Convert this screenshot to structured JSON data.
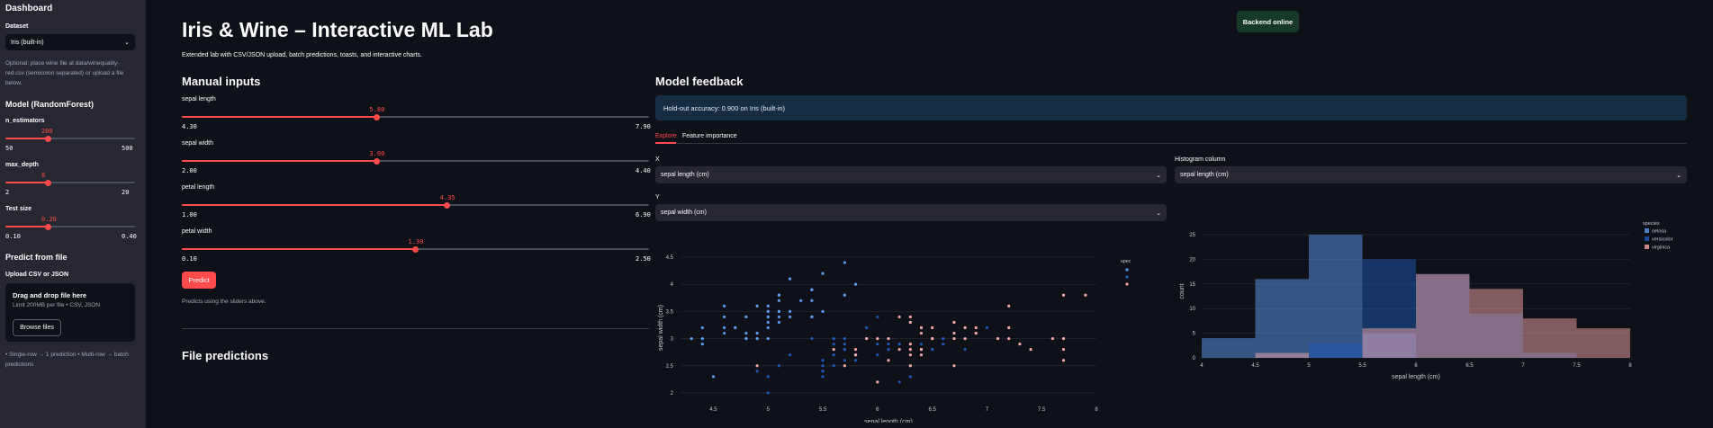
{
  "sidebar": {
    "title": "Dashboard",
    "dataset_label": "Dataset",
    "dataset_value": "Iris (built-in)",
    "dataset_help": [
      "Optional: place wine file at data/winequality-",
      "red.csv (semicolon separated) or upload a file",
      "below."
    ],
    "model_heading": "Model (RandomForest)",
    "sliders": [
      {
        "label": "n_estimators",
        "value": "200",
        "min": "50",
        "max": "500",
        "fraction": 0.333
      },
      {
        "label": "max_depth",
        "value": "8",
        "min": "2",
        "max": "20",
        "fraction": 0.333
      },
      {
        "label": "Test size",
        "value": "0.20",
        "min": "0.10",
        "max": "0.40",
        "fraction": 0.333
      }
    ],
    "predict_heading": "Predict from file",
    "upload_label": "Upload CSV or JSON",
    "upload_title": "Drag and drop file here",
    "upload_limit": "Limit 200MB per file • CSV, JSON",
    "browse_label": "Browse files",
    "note": [
      "• Single-row → 1 prediction • Multi-row → batch",
      "predictions"
    ]
  },
  "header": {
    "title": "Iris & Wine – Interactive ML Lab",
    "subtitle": "Extended lab with CSV/JSON upload, batch predictions, toasts, and interactive charts.",
    "backend_status": "Backend online"
  },
  "manual": {
    "heading": "Manual inputs",
    "sliders": [
      {
        "label": "sepal length",
        "value": "5.80",
        "min": "4.30",
        "max": "7.90",
        "fraction": 0.417
      },
      {
        "label": "sepal width",
        "value": "3.00",
        "min": "2.00",
        "max": "4.40",
        "fraction": 0.417
      },
      {
        "label": "petal length",
        "value": "4.35",
        "min": "1.00",
        "max": "6.90",
        "fraction": 0.568
      },
      {
        "label": "petal width",
        "value": "1.30",
        "min": "0.10",
        "max": "2.50",
        "fraction": 0.5
      }
    ],
    "predict_label": "Predict",
    "predict_caption": "Predicts using the sliders above.",
    "file_heading": "File predictions"
  },
  "feedback": {
    "heading": "Model feedback",
    "accuracy_text": "Hold-out accuracy: 0.900 on Iris (built-in)",
    "tabs": [
      "Explore",
      "Feature importance"
    ],
    "x_label": "X",
    "x_value": "sepal length (cm)",
    "y_label": "Y",
    "y_value": "sepal width (cm)",
    "hist_label": "Histogram column",
    "hist_value": "sepal length (cm)"
  },
  "colors": {
    "setosa": "#5b9bf2",
    "versicolor": "#1f57b8",
    "virginica": "#f4a6a6",
    "accent": "#ff4b4b"
  },
  "chart_data": [
    {
      "type": "scatter",
      "xlabel": "sepal length (cm)",
      "ylabel": "sepal width (cm)",
      "xlim": [
        4.2,
        8.0
      ],
      "ylim": [
        1.9,
        4.5
      ],
      "xticks": [
        4.5,
        5,
        5.5,
        6,
        6.5,
        7,
        7.5,
        8
      ],
      "yticks": [
        2,
        2.5,
        3,
        3.5,
        4,
        4.5
      ],
      "legend_title": "species",
      "series": [
        {
          "name": "setosa",
          "points": [
            [
              5.1,
              3.5
            ],
            [
              4.9,
              3.0
            ],
            [
              4.7,
              3.2
            ],
            [
              4.6,
              3.1
            ],
            [
              5.0,
              3.6
            ],
            [
              5.4,
              3.9
            ],
            [
              4.6,
              3.4
            ],
            [
              5.0,
              3.4
            ],
            [
              4.4,
              2.9
            ],
            [
              4.9,
              3.1
            ],
            [
              5.4,
              3.7
            ],
            [
              4.8,
              3.4
            ],
            [
              4.8,
              3.0
            ],
            [
              4.3,
              3.0
            ],
            [
              5.8,
              4.0
            ],
            [
              5.7,
              4.4
            ],
            [
              5.4,
              3.9
            ],
            [
              5.1,
              3.5
            ],
            [
              5.7,
              3.8
            ],
            [
              5.1,
              3.8
            ],
            [
              5.4,
              3.4
            ],
            [
              5.1,
              3.7
            ],
            [
              4.6,
              3.6
            ],
            [
              5.1,
              3.3
            ],
            [
              4.8,
              3.4
            ],
            [
              5.0,
              3.0
            ],
            [
              5.0,
              3.4
            ],
            [
              5.2,
              3.5
            ],
            [
              5.2,
              3.4
            ],
            [
              4.7,
              3.2
            ],
            [
              4.8,
              3.1
            ],
            [
              5.4,
              3.4
            ],
            [
              5.2,
              4.1
            ],
            [
              5.5,
              4.2
            ],
            [
              4.9,
              3.1
            ],
            [
              5.0,
              3.2
            ],
            [
              5.5,
              3.5
            ],
            [
              4.9,
              3.6
            ],
            [
              4.4,
              3.0
            ],
            [
              5.1,
              3.4
            ],
            [
              5.0,
              3.5
            ],
            [
              4.5,
              2.3
            ],
            [
              4.4,
              3.2
            ],
            [
              5.0,
              3.5
            ],
            [
              5.1,
              3.8
            ],
            [
              4.8,
              3.0
            ],
            [
              5.1,
              3.8
            ],
            [
              4.6,
              3.2
            ],
            [
              5.3,
              3.7
            ],
            [
              5.0,
              3.3
            ]
          ]
        },
        {
          "name": "versicolor",
          "points": [
            [
              7.0,
              3.2
            ],
            [
              6.4,
              3.2
            ],
            [
              6.9,
              3.1
            ],
            [
              5.5,
              2.3
            ],
            [
              6.5,
              2.8
            ],
            [
              5.7,
              2.8
            ],
            [
              6.3,
              3.3
            ],
            [
              4.9,
              2.4
            ],
            [
              6.6,
              2.9
            ],
            [
              5.2,
              2.7
            ],
            [
              5.0,
              2.0
            ],
            [
              5.9,
              3.0
            ],
            [
              6.0,
              2.2
            ],
            [
              6.1,
              2.9
            ],
            [
              5.6,
              2.9
            ],
            [
              6.7,
              3.1
            ],
            [
              5.6,
              3.0
            ],
            [
              5.8,
              2.7
            ],
            [
              6.2,
              2.2
            ],
            [
              5.6,
              2.5
            ],
            [
              5.9,
              3.2
            ],
            [
              6.1,
              2.8
            ],
            [
              6.3,
              2.5
            ],
            [
              6.1,
              2.8
            ],
            [
              6.4,
              2.9
            ],
            [
              6.6,
              3.0
            ],
            [
              6.8,
              2.8
            ],
            [
              6.7,
              3.0
            ],
            [
              6.0,
              2.9
            ],
            [
              5.7,
              2.6
            ],
            [
              5.5,
              2.4
            ],
            [
              5.5,
              2.4
            ],
            [
              5.8,
              2.7
            ],
            [
              6.0,
              2.7
            ],
            [
              5.4,
              3.0
            ],
            [
              6.0,
              3.4
            ],
            [
              6.7,
              3.1
            ],
            [
              6.3,
              2.3
            ],
            [
              5.6,
              3.0
            ],
            [
              5.5,
              2.5
            ],
            [
              5.5,
              2.6
            ],
            [
              6.1,
              3.0
            ],
            [
              5.8,
              2.6
            ],
            [
              5.0,
              2.3
            ],
            [
              5.6,
              2.7
            ],
            [
              5.7,
              3.0
            ],
            [
              5.7,
              2.9
            ],
            [
              6.2,
              2.9
            ],
            [
              5.1,
              2.5
            ],
            [
              5.7,
              2.8
            ]
          ]
        },
        {
          "name": "virginica",
          "points": [
            [
              6.3,
              3.3
            ],
            [
              5.8,
              2.7
            ],
            [
              7.1,
              3.0
            ],
            [
              6.3,
              2.9
            ],
            [
              6.5,
              3.0
            ],
            [
              7.6,
              3.0
            ],
            [
              4.9,
              2.5
            ],
            [
              7.3,
              2.9
            ],
            [
              6.7,
              2.5
            ],
            [
              7.2,
              3.6
            ],
            [
              6.5,
              3.2
            ],
            [
              6.4,
              2.7
            ],
            [
              6.8,
              3.0
            ],
            [
              5.7,
              2.5
            ],
            [
              5.8,
              2.8
            ],
            [
              6.4,
              3.2
            ],
            [
              6.5,
              3.0
            ],
            [
              7.7,
              3.8
            ],
            [
              7.7,
              2.6
            ],
            [
              6.0,
              2.2
            ],
            [
              6.9,
              3.2
            ],
            [
              5.6,
              2.8
            ],
            [
              7.7,
              2.8
            ],
            [
              6.3,
              2.7
            ],
            [
              6.7,
              3.3
            ],
            [
              7.2,
              3.2
            ],
            [
              6.2,
              2.8
            ],
            [
              6.1,
              3.0
            ],
            [
              6.4,
              2.8
            ],
            [
              7.2,
              3.0
            ],
            [
              7.4,
              2.8
            ],
            [
              7.9,
              3.8
            ],
            [
              6.4,
              2.8
            ],
            [
              6.3,
              2.8
            ],
            [
              6.1,
              2.6
            ],
            [
              7.7,
              3.0
            ],
            [
              6.3,
              3.4
            ],
            [
              6.4,
              3.1
            ],
            [
              6.0,
              3.0
            ],
            [
              6.9,
              3.1
            ],
            [
              6.7,
              3.1
            ],
            [
              6.9,
              3.1
            ],
            [
              5.8,
              2.7
            ],
            [
              6.8,
              3.2
            ],
            [
              6.7,
              3.3
            ],
            [
              6.7,
              3.0
            ],
            [
              6.3,
              2.5
            ],
            [
              6.5,
              3.0
            ],
            [
              6.2,
              3.4
            ],
            [
              5.9,
              3.0
            ]
          ]
        }
      ]
    },
    {
      "type": "bar",
      "subtype": "histogram",
      "xlabel": "sepal length (cm)",
      "ylabel": "count",
      "xlim": [
        4,
        8
      ],
      "ylim": [
        0,
        27
      ],
      "xticks": [
        4,
        4.5,
        5,
        5.5,
        6,
        6.5,
        7,
        7.5,
        8
      ],
      "yticks": [
        0,
        5,
        10,
        15,
        20,
        25
      ],
      "legend_title": "species",
      "bin_edges": [
        4,
        4.5,
        5,
        5.5,
        6,
        6.5,
        7,
        7.5,
        8
      ],
      "series": [
        {
          "name": "setosa",
          "values": [
            4,
            16,
            25,
            5,
            0,
            0,
            0,
            0
          ]
        },
        {
          "name": "versicolor",
          "values": [
            0,
            0,
            3,
            20,
            17,
            9,
            1,
            0
          ]
        },
        {
          "name": "virginica",
          "values": [
            0,
            1,
            0,
            6,
            17,
            14,
            8,
            6
          ]
        }
      ]
    }
  ]
}
